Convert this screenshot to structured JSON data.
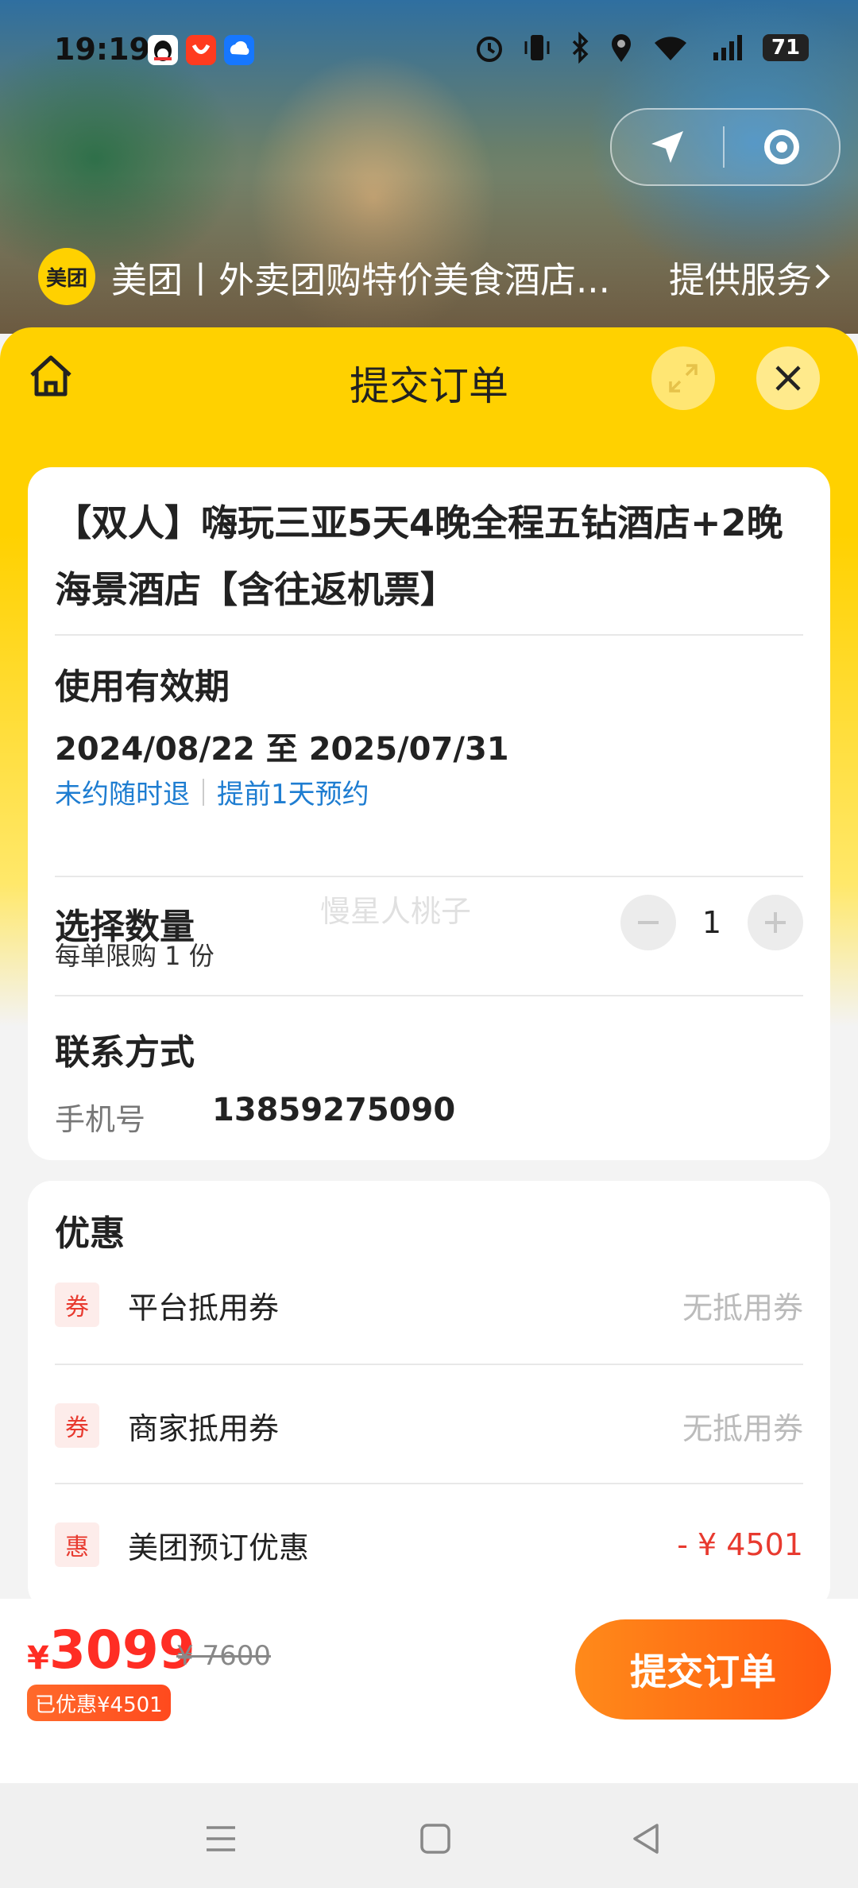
{
  "status_bar": {
    "time": "19:19",
    "battery": "71",
    "icons": [
      "qq-icon",
      "app-icon",
      "cloud-app-icon",
      "alarm-icon",
      "vibrate-icon",
      "bluetooth-icon",
      "location-icon",
      "wifi-icon",
      "signal-5g-icon",
      "battery-icon"
    ]
  },
  "service_bar": {
    "logo_text": "美团",
    "title": "美团丨外卖团购特价美食酒店...",
    "link": "提供服务"
  },
  "sheet": {
    "title": "提交订单"
  },
  "product": {
    "title": "【双人】嗨玩三亚5天4晚全程五钻酒店+2晚海景酒店【含往返机票】"
  },
  "validity": {
    "heading": "使用有效期",
    "range": "2024/08/22 至 2025/07/31",
    "tags": [
      "未约随时退",
      "提前1天预约"
    ]
  },
  "quantity": {
    "heading": "选择数量",
    "value": "1",
    "limit": "每单限购 1 份",
    "watermark": "慢星人桃子"
  },
  "contact": {
    "heading": "联系方式",
    "phone_label": "手机号",
    "phone_value": "13859275090"
  },
  "discounts": {
    "heading": "优惠",
    "rows": [
      {
        "badge": "券",
        "label": "平台抵用券",
        "value": "无抵用券"
      },
      {
        "badge": "券",
        "label": "商家抵用券",
        "value": "无抵用券"
      },
      {
        "badge": "惠",
        "label": "美团预订优惠",
        "value": "- ¥ 4501"
      }
    ]
  },
  "footer": {
    "currency": "¥",
    "price": "3099",
    "original_price": "¥ 7600",
    "discount_badge": "已优惠¥4501",
    "submit_label": "提交订单"
  },
  "colors": {
    "brand_yellow": "#ffd100",
    "price_red": "#ff2d24",
    "submit_orange": "#ff6a14",
    "link_blue": "#1e7dd1"
  }
}
